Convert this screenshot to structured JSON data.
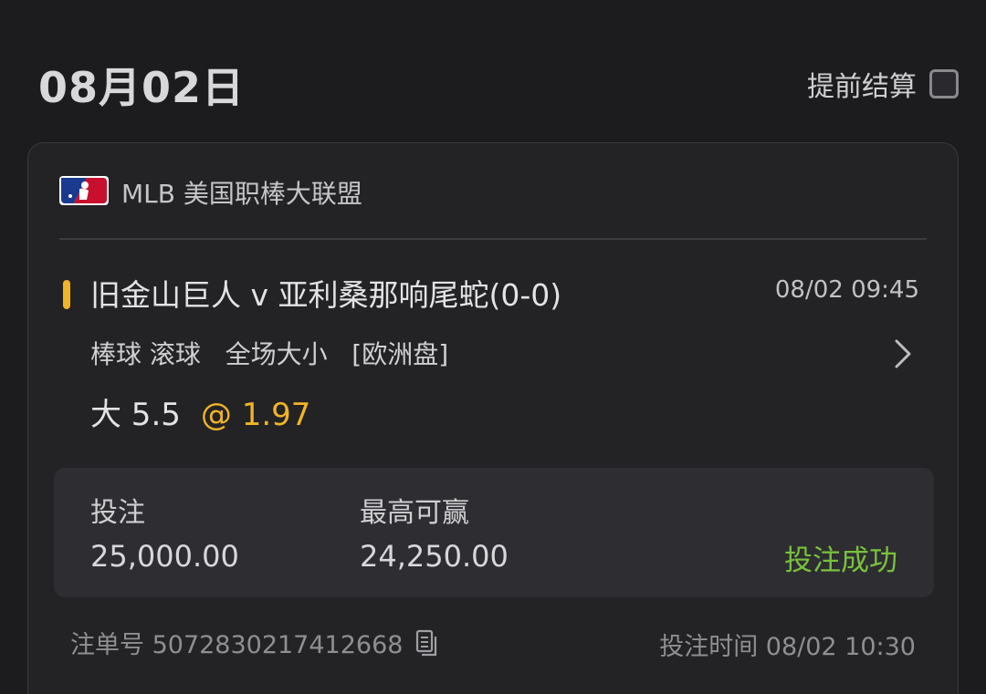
{
  "header": {
    "date": "08月02日",
    "early_settlement_label": "提前结算",
    "early_settlement_checked": false
  },
  "bet": {
    "league_icon": "mlb-logo-icon",
    "league": "MLB 美国职棒大联盟",
    "match": "旧金山巨人 v 亚利桑那响尾蛇(0-0)",
    "match_time": "08/02 09:45",
    "market": "棒球 滚球   全场大小   [欧洲盘]",
    "selection": "大 5.5",
    "odds": "@ 1.97",
    "stake_label": "投注",
    "stake_value": "25,000.00",
    "max_win_label": "最高可赢",
    "max_win_value": "24,250.00",
    "status": "投注成功",
    "bet_id_label": "注单号 5072830217412668",
    "copy_icon": "copy-icon",
    "bet_time": "投注时间 08/02 10:30"
  },
  "colors": {
    "background": "#1c1c1f",
    "card": "#232326",
    "accent": "#f0b429",
    "success": "#79c23c"
  }
}
